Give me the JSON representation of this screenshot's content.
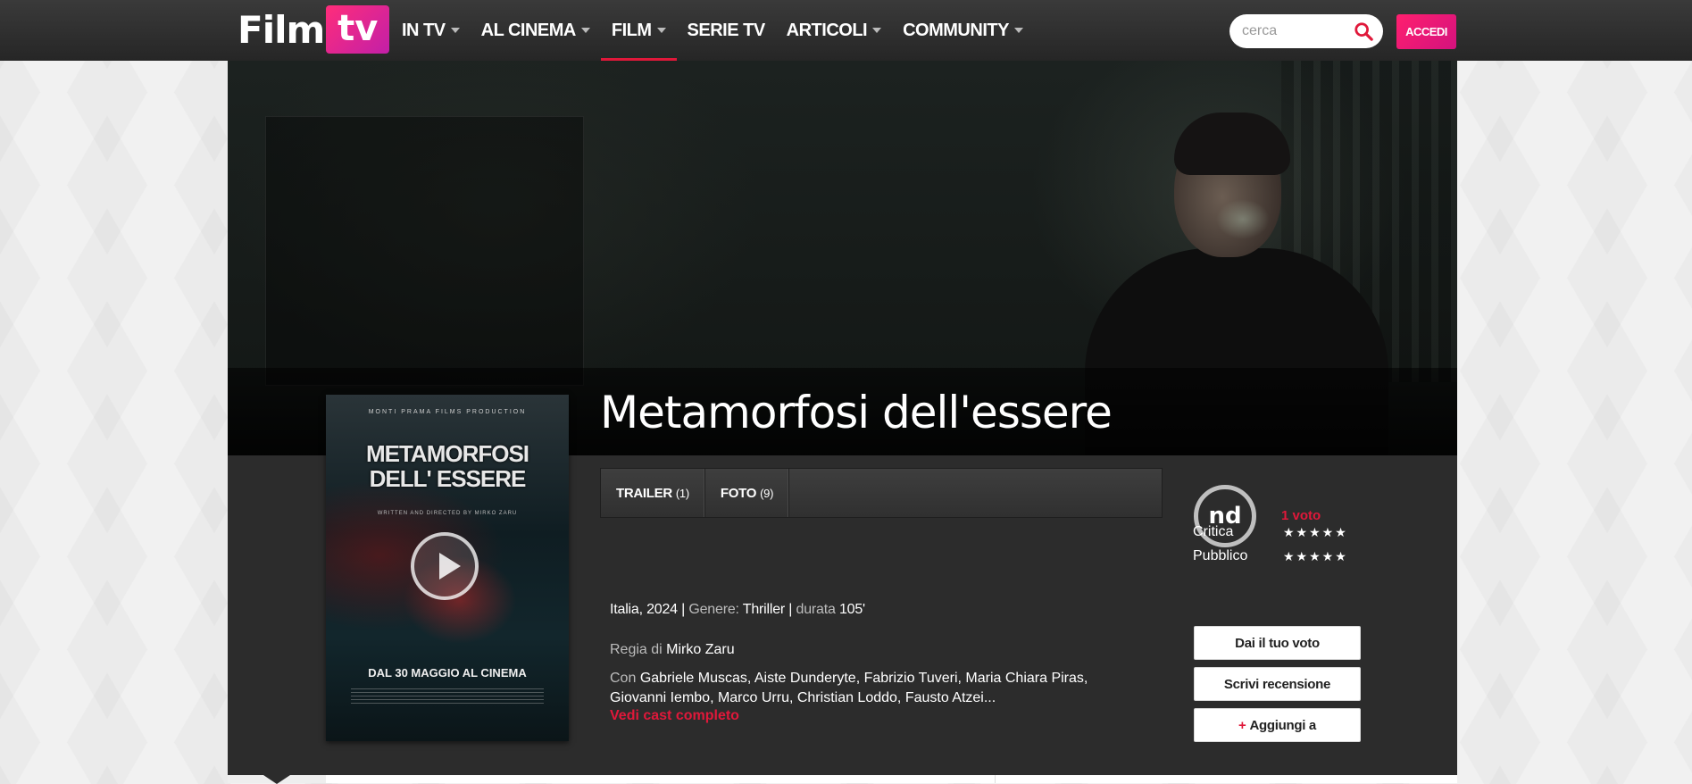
{
  "logo": {
    "film": "Film",
    "tv": "tv"
  },
  "nav": [
    {
      "label": "IN TV",
      "has_dropdown": true,
      "active": false
    },
    {
      "label": "AL CINEMA",
      "has_dropdown": true,
      "active": false
    },
    {
      "label": "FILM",
      "has_dropdown": true,
      "active": true
    },
    {
      "label": "SERIE TV",
      "has_dropdown": false,
      "active": false
    },
    {
      "label": "ARTICOLI",
      "has_dropdown": true,
      "active": false
    },
    {
      "label": "COMMUNITY",
      "has_dropdown": true,
      "active": false
    }
  ],
  "search": {
    "placeholder": "cerca",
    "value": ""
  },
  "login_label": "ACCEDI",
  "film": {
    "title": "Metamorfosi dell'essere",
    "tabs": [
      {
        "label": "TRAILER",
        "count": "(1)"
      },
      {
        "label": "FOTO",
        "count": "(9)"
      }
    ],
    "country_year": "Italia, 2024",
    "genre_label": "Genere:",
    "genre": "Thriller",
    "duration_label": "durata",
    "duration": "105'",
    "director_label": "Regia di",
    "director": "Mirko Zaru",
    "cast_label": "Con",
    "cast": "Gabriele Muscas, Aiste Dunderyte, Fabrizio Tuveri, Maria Chiara Piras, Giovanni Iembo, Marco Urru, Christian Loddo, Fausto Atzei...",
    "cast_link": "Vedi cast completo"
  },
  "poster": {
    "top_credit": "MONTI PRAMA FILMS PRODUCTION",
    "title_line1": "METAMORFOSI",
    "title_line2": "DELL' ESSERE",
    "tagline": "WRITTEN AND DIRECTED BY MIRKO ZARU",
    "release": "DAL 30 MAGGIO AL CINEMA"
  },
  "rating": {
    "score": "nd",
    "votes": "1 voto",
    "critica_label": "Critica",
    "pubblico_label": "Pubblico",
    "stars_glyph": "★★★★★"
  },
  "actions": {
    "vote": "Dai il tuo voto",
    "review": "Scrivi recensione",
    "add_plus": "+",
    "add": "Aggiungi a"
  },
  "colors": {
    "accent": "#e0183a",
    "brand_gradient_start": "#ff2d7a",
    "brand_gradient_end": "#c21fa8",
    "panel_bg": "#2c2c2c"
  }
}
